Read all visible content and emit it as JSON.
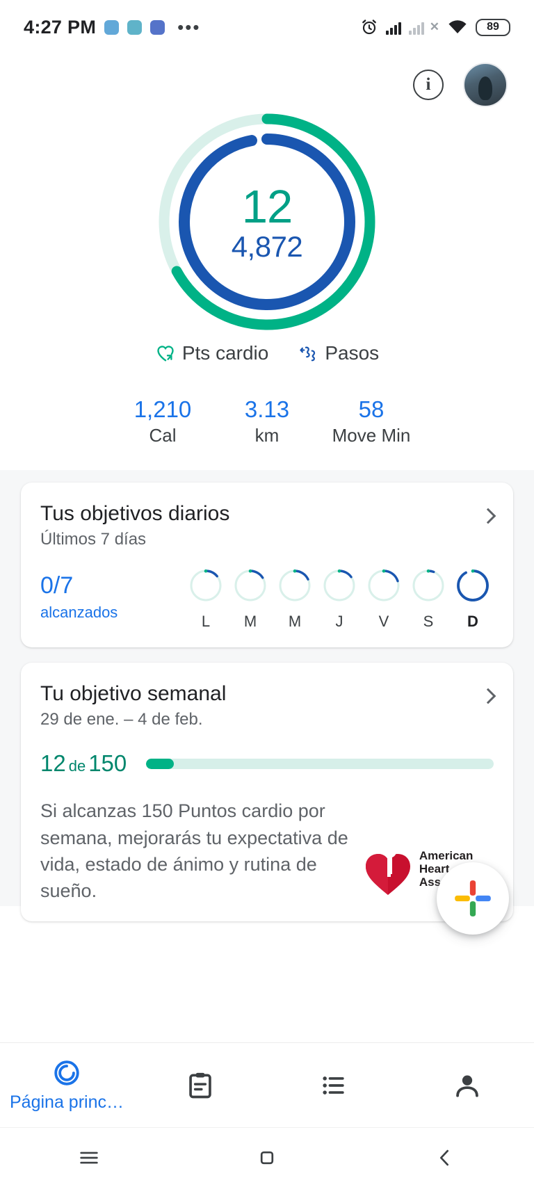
{
  "status_bar": {
    "time": "4:27 PM",
    "app_icons": [
      "telegram-icon",
      "telegram-icon",
      "discord-icon"
    ],
    "overflow": "•••",
    "alarm_icon": "alarm-icon",
    "signal_icon": "signal-bars-icon",
    "signal_no_sim_icon": "signal-no-service-icon",
    "wifi_icon": "wifi-icon",
    "battery_level": "89"
  },
  "header": {
    "info_label": "i",
    "info_icon": "info-circle-icon",
    "avatar_icon": "profile-avatar"
  },
  "rings": {
    "heart_points_value": "12",
    "steps_value": "4,872",
    "heart_points_percent": 67,
    "steps_percent": 97,
    "heart_color": "#00B286",
    "heart_track_color": "#d9f0ea",
    "steps_color": "#1A56B0",
    "steps_track_color": "#ffffff"
  },
  "legend": [
    {
      "label": "Pts cardio",
      "icon": "heart-cardio-icon",
      "color": "#00B286"
    },
    {
      "label": "Pasos",
      "icon": "steps-shoe-icon",
      "color": "#1A56B0"
    }
  ],
  "stats": [
    {
      "value": "1,210",
      "label": "Cal"
    },
    {
      "value": "3.13",
      "label": "km"
    },
    {
      "value": "58",
      "label": "Move Min"
    }
  ],
  "daily_goals_card": {
    "title": "Tus objetivos diarios",
    "subtitle": "Últimos 7 días",
    "count": "0/7",
    "count_label": "alcanzados",
    "chevron_icon": "chevron-right-icon",
    "days": [
      {
        "label": "L",
        "percent": 14,
        "today": false
      },
      {
        "label": "M",
        "percent": 16,
        "today": false
      },
      {
        "label": "M",
        "percent": 18,
        "today": false
      },
      {
        "label": "J",
        "percent": 15,
        "today": false
      },
      {
        "label": "V",
        "percent": 20,
        "today": false
      },
      {
        "label": "S",
        "percent": 6,
        "today": false
      },
      {
        "label": "D",
        "percent": 67,
        "today": true
      }
    ]
  },
  "weekly_goal_card": {
    "title": "Tu objetivo semanal",
    "date_range": "29 de ene. – 4 de feb.",
    "current": "12",
    "connector": "de",
    "target": "150",
    "progress_percent": 8,
    "chevron_icon": "chevron-right-icon",
    "description": "Si alcanzas 150 Puntos cardio por semana, mejorarás tu expectativa de vida, estado de ánimo y rutina de sueño.",
    "partner_logo": "american-heart-association-logo",
    "partner_name_line1": "American",
    "partner_name_line2": "Heart",
    "partner_name_line3": "Association."
  },
  "fab": {
    "icon": "google-fit-plus-icon",
    "label": "Añadir"
  },
  "bottom_nav": [
    {
      "label": "Página princ…",
      "icon": "home-ring-icon",
      "active": true
    },
    {
      "label": "",
      "icon": "journal-clipboard-icon",
      "active": false
    },
    {
      "label": "",
      "icon": "list-icon",
      "active": false
    },
    {
      "label": "",
      "icon": "profile-person-icon",
      "active": false
    }
  ],
  "system_nav": [
    {
      "icon": "recents-menu-icon"
    },
    {
      "icon": "home-square-icon"
    },
    {
      "icon": "back-chevron-icon"
    }
  ]
}
